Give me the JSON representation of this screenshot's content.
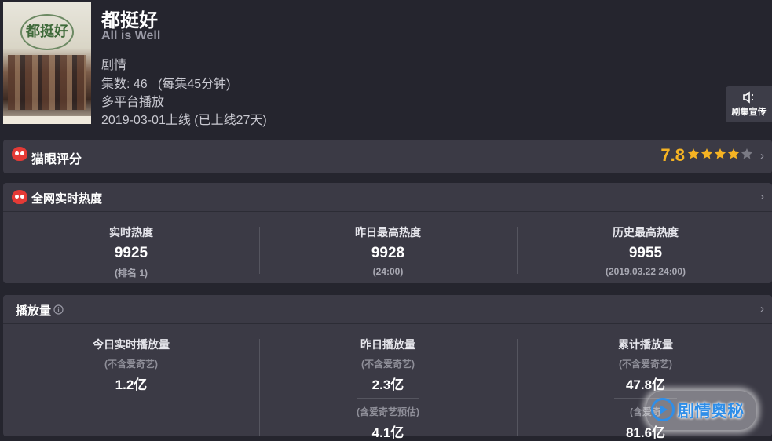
{
  "show": {
    "title": "都挺好",
    "subtitle": "All is Well",
    "genre": "剧情",
    "episodes": "集数: 46",
    "duration": "(每集45分钟)",
    "platform": "多平台播放",
    "release": "2019-03-01上线 (已上线27天)",
    "poster_art_text": "都挺好"
  },
  "promo": {
    "label": "剧集宣传",
    "icon": "speaker-icon"
  },
  "maoyan_rating": {
    "title": "猫眼评分",
    "score": "7.8",
    "stars_filled": 4,
    "stars_total": 5
  },
  "heat": {
    "title": "全网实时热度",
    "columns": [
      {
        "label": "实时热度",
        "value": "9925",
        "note": "(排名 1)"
      },
      {
        "label": "昨日最高热度",
        "value": "9928",
        "note": "(24:00)"
      },
      {
        "label": "历史最高热度",
        "value": "9955",
        "note": "(2019.03.22 24:00)"
      }
    ]
  },
  "plays": {
    "title": "播放量",
    "info_icon": "info-icon",
    "columns": [
      {
        "label": "今日实时播放量",
        "note": "(不含爱奇艺)",
        "value": "1.2亿"
      },
      {
        "label": "昨日播放量",
        "note": "(不含爱奇艺)",
        "value": "2.3亿",
        "note2": "(含爱奇艺预估)",
        "value2": "4.1亿"
      },
      {
        "label": "累计播放量",
        "note": "(不含爱奇艺)",
        "value": "47.8亿",
        "note2": "(含爱奇",
        "value2": "81.6亿"
      }
    ]
  },
  "watermark": {
    "text": "剧情奥秘"
  },
  "colors": {
    "background": "#25252e",
    "card": "#3b3a45",
    "accent_star": "#f5b323",
    "maoyan_red": "#e53a36",
    "watermark_blue": "#2f8ee8"
  }
}
